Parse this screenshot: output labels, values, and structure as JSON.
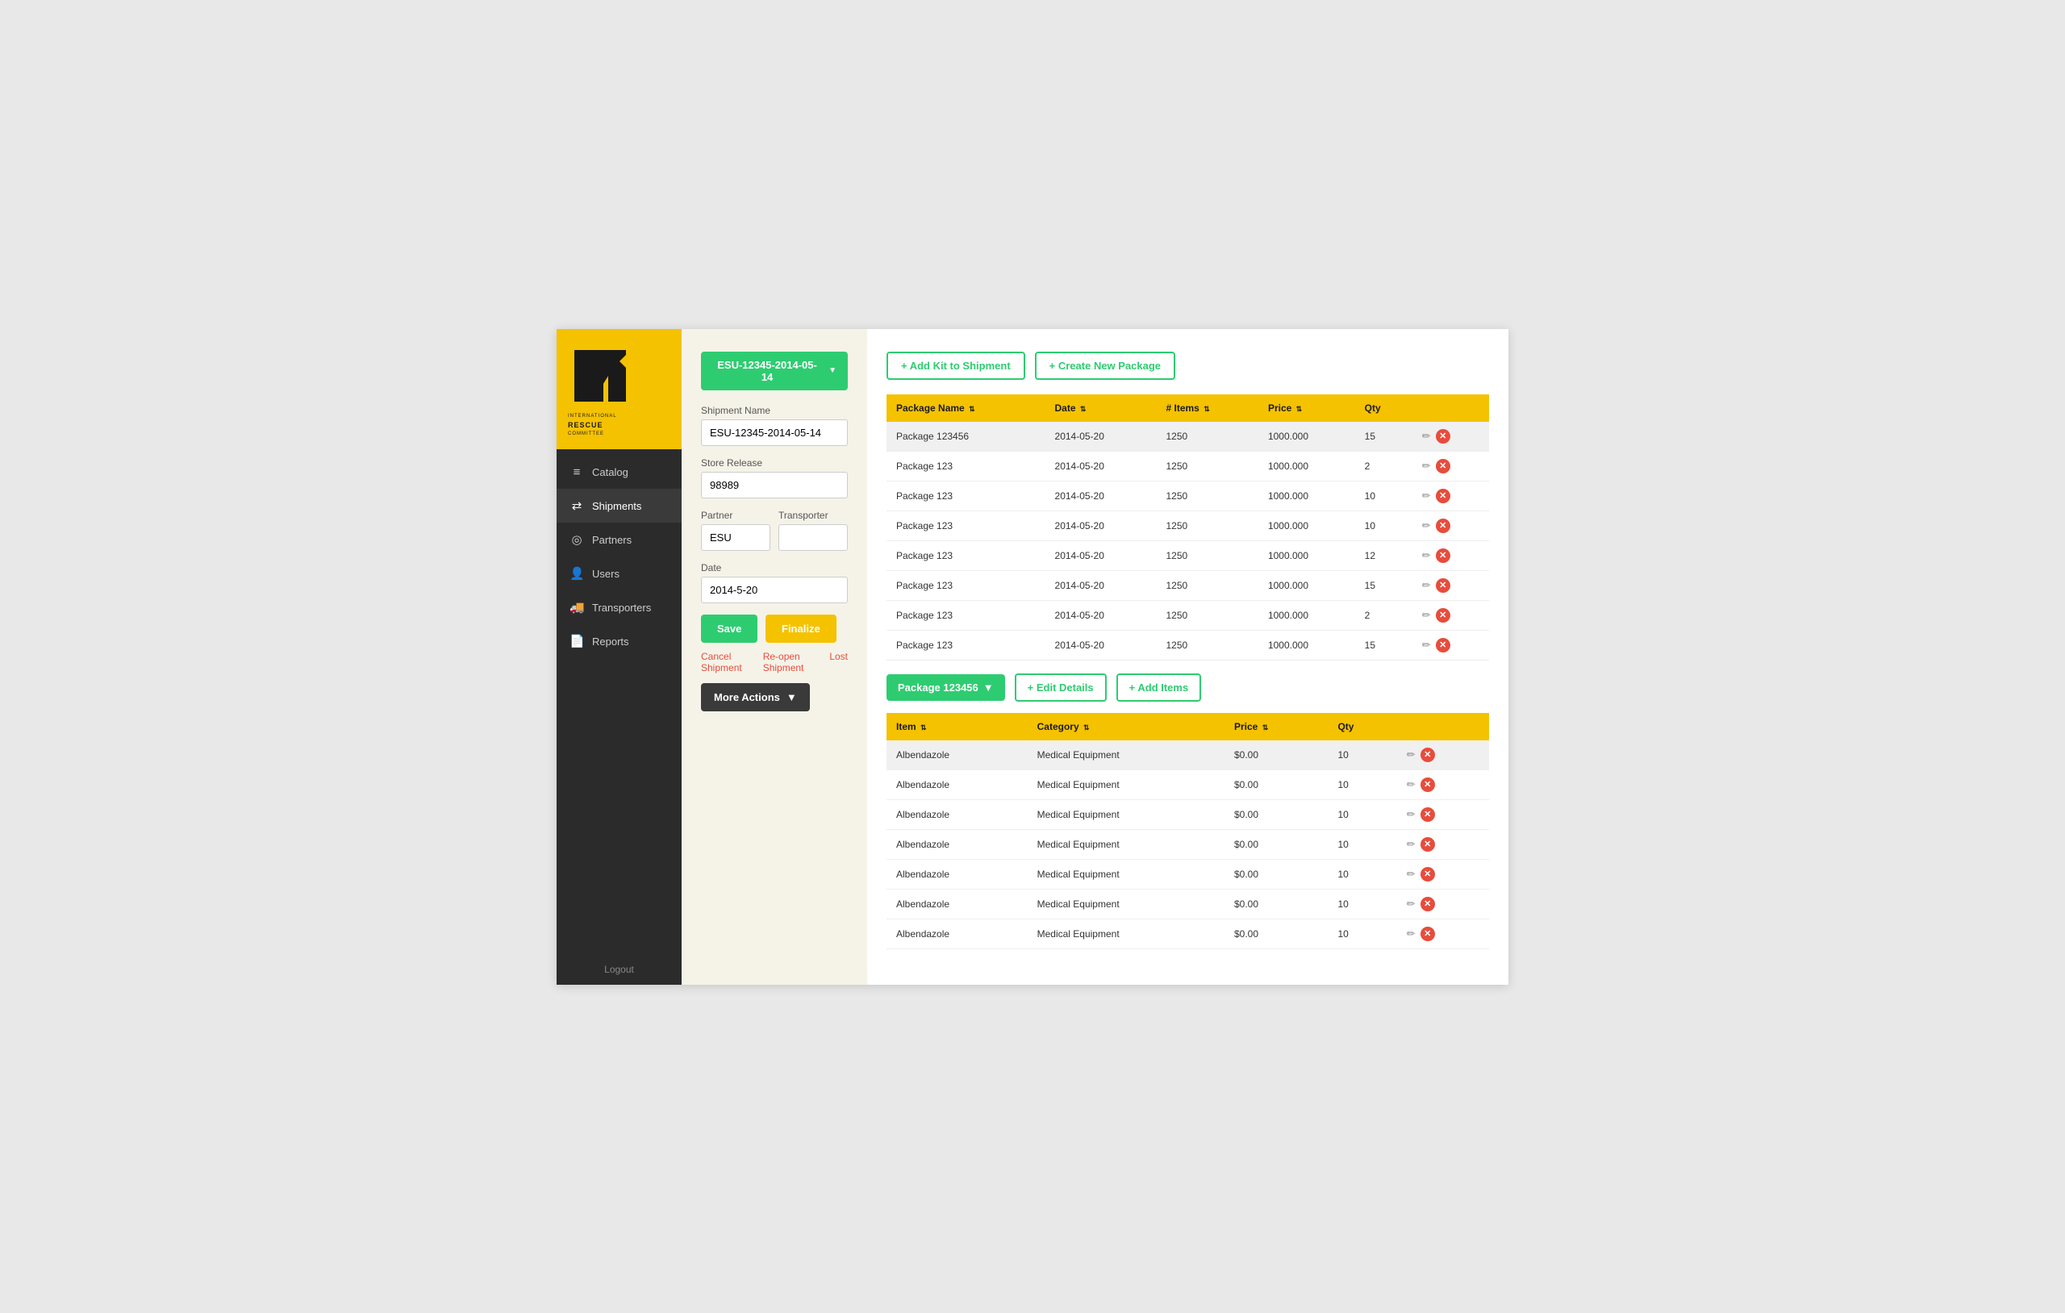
{
  "colors": {
    "yellow": "#f5c200",
    "green": "#2ecc71",
    "dark": "#2b2b2b",
    "red": "#e74c3c"
  },
  "sidebar": {
    "logo_line1": "INTERNATIONAL",
    "logo_line2": "RESCUE",
    "logo_line3": "COMMITTEE",
    "items": [
      {
        "id": "catalog",
        "label": "Catalog",
        "icon": "≡"
      },
      {
        "id": "shipments",
        "label": "Shipments",
        "icon": "⇄",
        "active": true
      },
      {
        "id": "partners",
        "label": "Partners",
        "icon": "◎"
      },
      {
        "id": "users",
        "label": "Users",
        "icon": "👤"
      },
      {
        "id": "transporters",
        "label": "Transporters",
        "icon": "🚚"
      },
      {
        "id": "reports",
        "label": "Reports",
        "icon": "📄"
      }
    ],
    "logout_label": "Logout"
  },
  "form": {
    "shipment_id": "ESU-12345-2014-05-14",
    "shipment_name_label": "Shipment Name",
    "shipment_name_value": "ESU-12345-2014-05-14",
    "store_release_label": "Store Release",
    "store_release_value": "98989",
    "partner_label": "Partner",
    "partner_value": "ESU",
    "transporter_label": "Transporter",
    "transporter_value": "",
    "date_label": "Date",
    "date_value": "2014-5-20",
    "save_label": "Save",
    "finalize_label": "Finalize",
    "cancel_label": "Cancel Shipment",
    "reopen_label": "Re-open Shipment",
    "lost_label": "Lost",
    "more_actions_label": "More Actions"
  },
  "top_buttons": {
    "add_kit_label": "+ Add Kit to Shipment",
    "create_package_label": "+ Create New Package"
  },
  "packages_table": {
    "headers": [
      "Package Name",
      "Date",
      "# Items",
      "Price",
      "Qty",
      ""
    ],
    "rows": [
      {
        "name": "Package 123456",
        "date": "2014-05-20",
        "items": "1250",
        "price": "1000.000",
        "qty": "15",
        "highlighted": true
      },
      {
        "name": "Package 123",
        "date": "2014-05-20",
        "items": "1250",
        "price": "1000.000",
        "qty": "2"
      },
      {
        "name": "Package 123",
        "date": "2014-05-20",
        "items": "1250",
        "price": "1000.000",
        "qty": "10"
      },
      {
        "name": "Package 123",
        "date": "2014-05-20",
        "items": "1250",
        "price": "1000.000",
        "qty": "10"
      },
      {
        "name": "Package 123",
        "date": "2014-05-20",
        "items": "1250",
        "price": "1000.000",
        "qty": "12"
      },
      {
        "name": "Package 123",
        "date": "2014-05-20",
        "items": "1250",
        "price": "1000.000",
        "qty": "15"
      },
      {
        "name": "Package 123",
        "date": "2014-05-20",
        "items": "1250",
        "price": "1000.000",
        "qty": "2"
      },
      {
        "name": "Package 123",
        "date": "2014-05-20",
        "items": "1250",
        "price": "1000.000",
        "qty": "15"
      }
    ]
  },
  "selected_package": {
    "label": "Package 123456",
    "edit_label": "+ Edit Details",
    "add_items_label": "+ Add Items"
  },
  "items_table": {
    "headers": [
      "Item",
      "Category",
      "Price",
      "Qty",
      ""
    ],
    "rows": [
      {
        "item": "Albendazole",
        "category": "Medical Equipment",
        "price": "$0.00",
        "qty": "10"
      },
      {
        "item": "Albendazole",
        "category": "Medical Equipment",
        "price": "$0.00",
        "qty": "10"
      },
      {
        "item": "Albendazole",
        "category": "Medical Equipment",
        "price": "$0.00",
        "qty": "10"
      },
      {
        "item": "Albendazole",
        "category": "Medical Equipment",
        "price": "$0.00",
        "qty": "10"
      },
      {
        "item": "Albendazole",
        "category": "Medical Equipment",
        "price": "$0.00",
        "qty": "10"
      },
      {
        "item": "Albendazole",
        "category": "Medical Equipment",
        "price": "$0.00",
        "qty": "10"
      },
      {
        "item": "Albendazole",
        "category": "Medical Equipment",
        "price": "$0.00",
        "qty": "10"
      }
    ]
  }
}
